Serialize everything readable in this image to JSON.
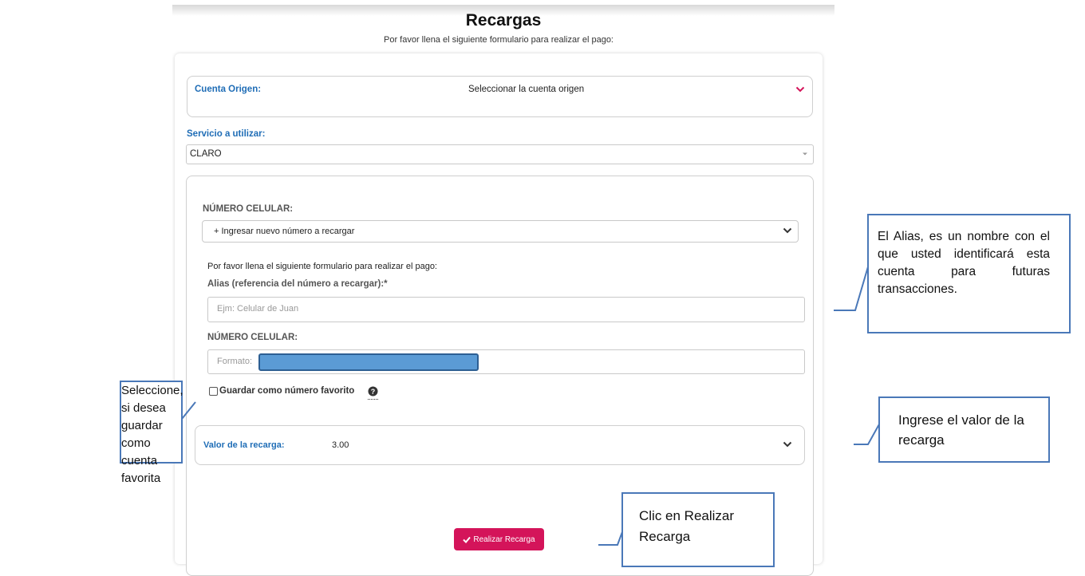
{
  "header": {
    "title": "Recargas",
    "subtitle": "Por favor llena el siguiente formulario para realizar el pago:"
  },
  "cuenta_origen": {
    "label": "Cuenta Origen:",
    "value": "Seleccionar la cuenta origen"
  },
  "servicio": {
    "label": "Servicio a utilizar:",
    "value": "CLARO"
  },
  "numero_select": {
    "label": "NÚMERO CELULAR:",
    "value": "+ Ingresar nuevo número a recargar"
  },
  "form": {
    "instructions": "Por favor llena el siguiente formulario para realizar el pago:",
    "alias_label": "Alias (referencia del número a recargar):*",
    "alias_placeholder": "Ejm: Celular de Juan",
    "numero_label": "NÚMERO CELULAR:",
    "numero_placeholder": "Formato:"
  },
  "favorito": {
    "label": "Guardar como número favorito",
    "checked": false
  },
  "valor": {
    "label": "Valor de la recarga:",
    "value": "3.00"
  },
  "submit": {
    "label": "Realizar Recarga",
    "color": "#d4145a"
  },
  "callouts": {
    "alias": "El Alias, es un nombre con el que usted identificará esta cuenta para futuras transacciones.",
    "favorito": "Seleccione, si desea guardar como cuenta favorita",
    "valor": "Ingrese el valor de la recarga",
    "realizar": "Clic en Realizar Recarga"
  },
  "colors": {
    "accent_blue": "#1f6db6",
    "callout_border": "#4a78b8",
    "chevron_red": "#d4145a"
  }
}
